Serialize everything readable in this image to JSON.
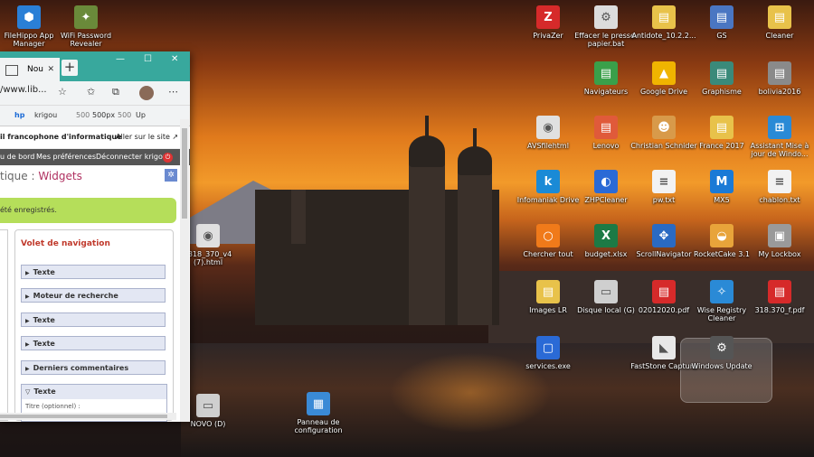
{
  "desktop_icons": [
    {
      "id": "filehippo",
      "label": "FileHippo App Manager",
      "icon": "filehippo-icon",
      "color": "#2a7fd6",
      "glyph": "⬢"
    },
    {
      "id": "wifipw",
      "label": "WiFi Password Revealer",
      "icon": "wifi-icon",
      "color": "#6a8a3a",
      "glyph": "✦"
    },
    {
      "id": "privazer",
      "label": "PrivaZer",
      "icon": "privazer-icon",
      "color": "#d62a2a",
      "glyph": "Z"
    },
    {
      "id": "effacer",
      "label": "Effacer le presse-papier.bat",
      "icon": "bat-file-icon",
      "color": "#dcdcdc",
      "glyph": "⚙"
    },
    {
      "id": "antidote",
      "label": "Antidote_10.2.2...",
      "icon": "folder-icon",
      "color": "#e8c24a",
      "glyph": "▤"
    },
    {
      "id": "gs",
      "label": "GS",
      "icon": "folder-icon",
      "color": "#4a76c2",
      "glyph": "▤"
    },
    {
      "id": "cleaner",
      "label": "Cleaner",
      "icon": "folder-icon",
      "color": "#e8c24a",
      "glyph": "▤"
    },
    {
      "id": "navigateurs",
      "label": "Navigateurs",
      "icon": "folder-icon",
      "color": "#3aa04a",
      "glyph": "▤"
    },
    {
      "id": "googledrive",
      "label": "Google Drive",
      "icon": "google-drive-icon",
      "color": "#f0b400",
      "glyph": "▲"
    },
    {
      "id": "graphisme",
      "label": "Graphisme",
      "icon": "folder-icon",
      "color": "#3a8a7a",
      "glyph": "▤"
    },
    {
      "id": "bolivia",
      "label": "bolivia2016",
      "icon": "folder-icon",
      "color": "#8a8a8a",
      "glyph": "▤"
    },
    {
      "id": "avsfile",
      "label": "AVSfilehtml",
      "icon": "chrome-icon",
      "color": "#e0e0e0",
      "glyph": "◉"
    },
    {
      "id": "lenovo",
      "label": "Lenovo",
      "icon": "folder-icon",
      "color": "#e05a3a",
      "glyph": "▤"
    },
    {
      "id": "christian",
      "label": "Christian Schnider",
      "icon": "user-folder-icon",
      "color": "#d89a4a",
      "glyph": "☻"
    },
    {
      "id": "france2017",
      "label": "France 2017",
      "icon": "folder-icon",
      "color": "#e8c24a",
      "glyph": "▤"
    },
    {
      "id": "assistant",
      "label": "Assistant Mise à jour de Windo...",
      "icon": "windows-icon",
      "color": "#2a8ad6",
      "glyph": "⊞"
    },
    {
      "id": "infomaniak",
      "label": "Infomaniak Drive",
      "icon": "kdrive-icon",
      "color": "#1a8ad6",
      "glyph": "k"
    },
    {
      "id": "zhpcleaner",
      "label": "ZHPCleaner",
      "icon": "zhp-icon",
      "color": "#2a6ad6",
      "glyph": "◐"
    },
    {
      "id": "pwtxt",
      "label": "pw.txt",
      "icon": "text-file-icon",
      "color": "#f2f2f2",
      "glyph": "≡"
    },
    {
      "id": "mx5",
      "label": "MX5",
      "icon": "maxthon-icon",
      "color": "#1a7ad6",
      "glyph": "M"
    },
    {
      "id": "chablon",
      "label": "chablon.txt",
      "icon": "text-file-icon",
      "color": "#f2f2f2",
      "glyph": "≡"
    },
    {
      "id": "cherchertout",
      "label": "Chercher tout",
      "icon": "search-everything-icon",
      "color": "#f07a1a",
      "glyph": "○"
    },
    {
      "id": "budget",
      "label": "budget.xlsx",
      "icon": "excel-icon",
      "color": "#1d7a45",
      "glyph": "X"
    },
    {
      "id": "scrollnav",
      "label": "ScrollNavigator",
      "icon": "scroll-icon",
      "color": "#2a6ac2",
      "glyph": "✥"
    },
    {
      "id": "rocketcake",
      "label": "RocketCake 3.1",
      "icon": "rocketcake-icon",
      "color": "#e8a43a",
      "glyph": "◒"
    },
    {
      "id": "mylockbox",
      "label": "My Lockbox",
      "icon": "lockbox-icon",
      "color": "#9a9a9a",
      "glyph": "▣"
    },
    {
      "id": "imageslr",
      "label": "Images LR",
      "icon": "folder-icon",
      "color": "#e8c24a",
      "glyph": "▤"
    },
    {
      "id": "disquelocal",
      "label": "Disque local (G)",
      "icon": "drive-icon",
      "color": "#cfcfcf",
      "glyph": "▭"
    },
    {
      "id": "pdf0201",
      "label": "02012020.pdf",
      "icon": "pdf-icon",
      "color": "#d62a2a",
      "glyph": "▤"
    },
    {
      "id": "wiseregistry",
      "label": "Wise Registry Cleaner",
      "icon": "wise-icon",
      "color": "#2a8ad6",
      "glyph": "✧"
    },
    {
      "id": "pdf318",
      "label": "318.370_f.pdf",
      "icon": "pdf-icon",
      "color": "#d62a2a",
      "glyph": "▤"
    },
    {
      "id": "services",
      "label": "services.exe",
      "icon": "exe-icon",
      "color": "#2a6ad6",
      "glyph": "▢"
    },
    {
      "id": "faststone",
      "label": "FastStone Capture",
      "icon": "faststone-icon",
      "color": "#e8e8e8",
      "glyph": "◣"
    },
    {
      "id": "winupdate",
      "label": "Windows Update",
      "icon": "gear-icon",
      "color": "#555555",
      "glyph": "⚙"
    },
    {
      "id": "html318",
      "label": "_318_370_v4 (7).html",
      "icon": "chrome-icon",
      "color": "#e0e0e0",
      "glyph": "◉"
    },
    {
      "id": "novo",
      "label": "NOVO (D)",
      "icon": "drive-icon",
      "color": "#cfcfcf",
      "glyph": "▭"
    },
    {
      "id": "panneau",
      "label": "Panneau de configuration",
      "icon": "control-panel-icon",
      "color": "#3a8ad6",
      "glyph": "▦"
    }
  ],
  "browser": {
    "tab_label": "Nou",
    "url": "/www.lib...",
    "bookmarks": [
      "krigou",
      "500px",
      "Up"
    ],
    "site_title": "il francophone d'informatique",
    "site_link": "Aller sur le site ↗",
    "admin_links": [
      "u de bord",
      "Mes préférences",
      "Déconnecter krigou"
    ],
    "breadcrumb_prefix": "tique : ",
    "breadcrumb_current": "Widgets",
    "notice": "été enregistrés.",
    "panel_title": "Volet de navigation",
    "widgets": [
      "Texte",
      "Moteur de recherche",
      "Texte",
      "Texte",
      "Derniers commentaires"
    ],
    "open_widget": "Texte",
    "open_widget_field": "Titre (optionnel) :"
  }
}
